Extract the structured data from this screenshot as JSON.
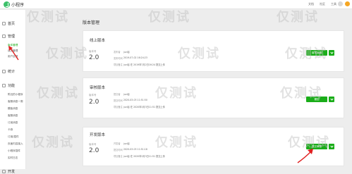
{
  "header": {
    "app_name": "小程序",
    "links": [
      "文档",
      "社区",
      "工具"
    ]
  },
  "sidebar": {
    "groups": [
      {
        "label": "首页",
        "icon": "home-icon"
      },
      {
        "label": "管理",
        "icon": "folder-icon"
      },
      {
        "label": "统计",
        "icon": "chart-icon"
      },
      {
        "label": "功能",
        "icon": "gear-icon"
      },
      {
        "label": "开发",
        "icon": "code-icon"
      }
    ],
    "manage_items": [
      "版本管理",
      "成员管理",
      "用户反馈"
    ],
    "feature_items": [
      "附近的小程序",
      "客服消息一周",
      "模板消息",
      "客服消息",
      "订阅消息",
      "卡券",
      "订阅/插件",
      "页面内容接入",
      "小程序插件",
      "实时日志"
    ]
  },
  "page_title": "版本管理",
  "online": {
    "title": "线上版本",
    "version_label": "版本号",
    "version": "2.0",
    "rows": [
      {
        "key": "发布者",
        "val": "juvi谷"
      },
      {
        "key": "发布时间",
        "val": "2019-07-02 16:24:23"
      },
      {
        "key": "项目备注",
        "val": "juvi谷 在 2019年7月2日16:24 提交上传"
      }
    ],
    "btn_label": "版本回退"
  },
  "review": {
    "title": "审核版本",
    "version_label": "版本号",
    "version": "2.0",
    "rows": [
      {
        "key": "提交者",
        "val": "juvi谷"
      },
      {
        "key": "提交时间",
        "val": "2020-03-03 11:51:50"
      },
      {
        "key": "项目备注",
        "val": "juvi谷 在 2020年3月3日11:51 提交上传"
      }
    ],
    "btn_label": "撤回"
  },
  "dev": {
    "title": "开发版本",
    "version_label": "版本号",
    "version": "2.0",
    "rows": [
      {
        "key": "开发者",
        "val": "juvi谷"
      },
      {
        "key": "提交时间",
        "val": "2020-03-03 11:51:18"
      },
      {
        "key": "项目备注",
        "val": "juvi谷 在 2020年3月3日11:51 提交上传"
      }
    ],
    "btn_label": "提交审核"
  },
  "watermark": "仅测试",
  "colors": {
    "accent": "#1aad19",
    "annotation_arrow": "#e02020"
  }
}
